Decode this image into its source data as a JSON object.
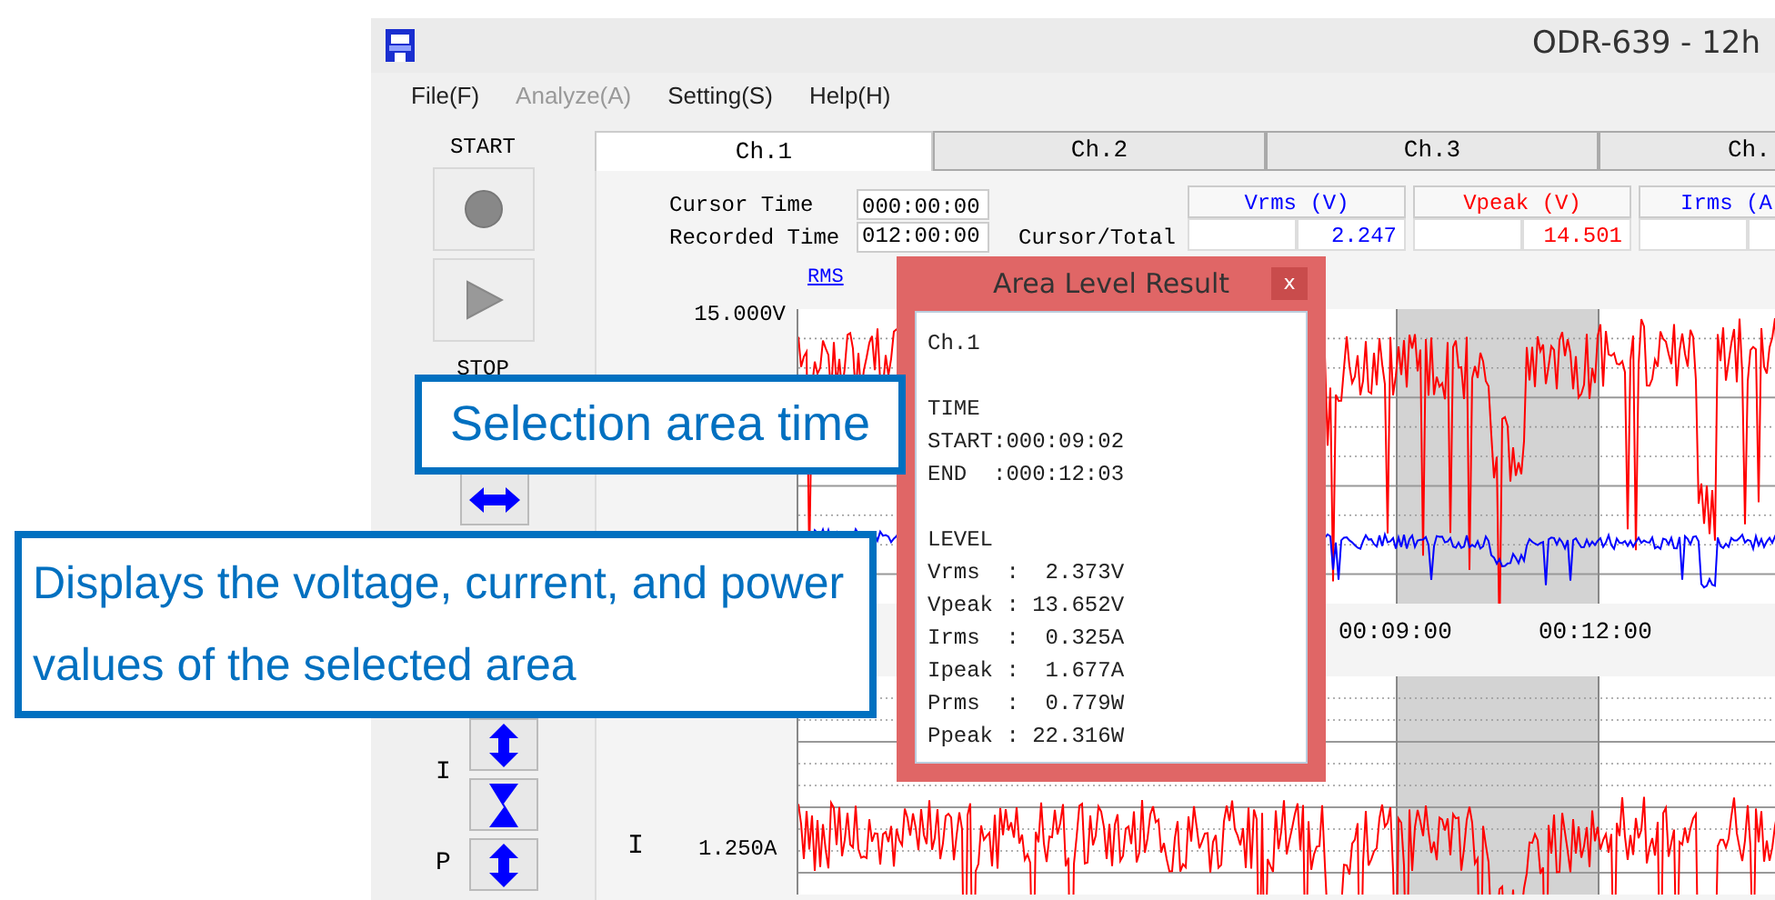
{
  "window": {
    "title": "ODR-639 - 12h"
  },
  "menu": [
    {
      "label": "File(F)",
      "disabled": false
    },
    {
      "label": "Analyze(A)",
      "disabled": true
    },
    {
      "label": "Setting(S)",
      "disabled": false
    },
    {
      "label": "Help(H)",
      "disabled": false
    }
  ],
  "toolbar": {
    "start_label": "START",
    "stop_label": "STOP",
    "current_label": "I",
    "power_label": "P"
  },
  "tabs": [
    {
      "label": "Ch.1",
      "selected": true
    },
    {
      "label": "Ch.2",
      "selected": false
    },
    {
      "label": "Ch.3",
      "selected": false
    },
    {
      "label": "Ch.",
      "selected": false
    }
  ],
  "cursor_time": {
    "label": "Cursor Time",
    "value": "000:00:00"
  },
  "recorded_time": {
    "label": "Recorded Time",
    "value": "012:00:00"
  },
  "cursor_total_label": "Cursor/Total",
  "readings": [
    {
      "name": "Vrms (V)",
      "value": "2.247",
      "color": "#0000ff"
    },
    {
      "name": "Vpeak (V)",
      "value": "14.501",
      "color": "#ff0000"
    },
    {
      "name": "Irms (A",
      "color": "#0000ff"
    }
  ],
  "graph": {
    "mode_link": "RMS",
    "voltage_top": "15.000V",
    "current_symbol": "I",
    "current_label": "1.250A",
    "time_labels": [
      "00:09:00",
      "00:12:00"
    ]
  },
  "dialog": {
    "title": "Area Level Result",
    "close": "x",
    "sections": [
      [
        "Ch.1"
      ],
      [
        "TIME",
        "START:000:09:02",
        "END  :000:12:03"
      ],
      [
        "LEVEL",
        "Vrms  :  2.373V",
        "Vpeak : 13.652V",
        "Irms  :  0.325A",
        "Ipeak :  1.677A",
        "Prms  :  0.779W",
        "Ppeak : 22.316W"
      ]
    ]
  },
  "callouts": [
    "Selection area time",
    "Displays the voltage, current, and power values of the selected area"
  ]
}
